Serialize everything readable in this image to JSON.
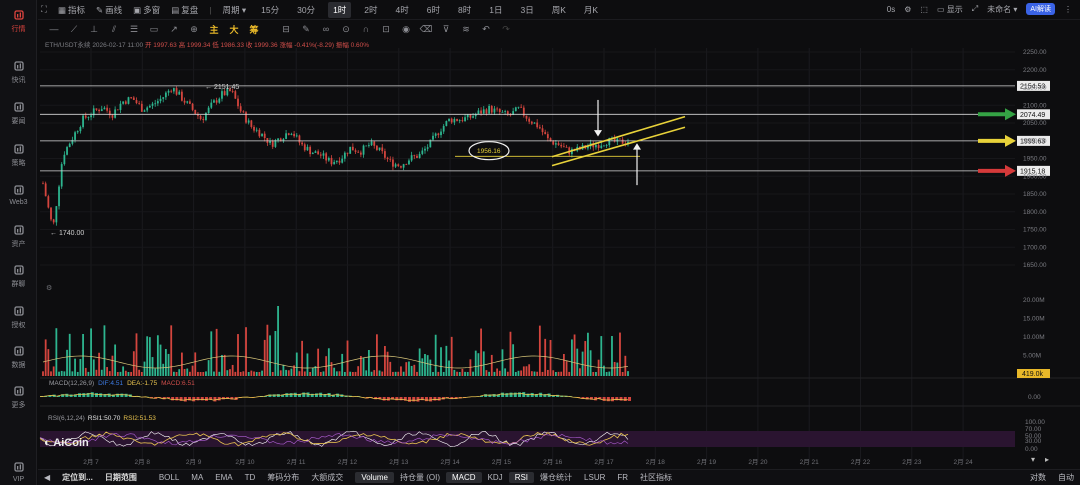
{
  "sidebar": {
    "items": [
      {
        "label": "行情",
        "icon": "chart-bars-icon",
        "active": true
      },
      {
        "label": "快讯",
        "icon": "news-icon"
      },
      {
        "label": "要闻",
        "icon": "document-icon"
      },
      {
        "label": "策略",
        "icon": "strategy-icon"
      },
      {
        "label": "Web3",
        "icon": "web3-icon"
      },
      {
        "label": "资产",
        "icon": "wallet-icon"
      },
      {
        "label": "群聊",
        "icon": "chat-icon"
      },
      {
        "label": "授权",
        "icon": "key-icon"
      },
      {
        "label": "数据",
        "icon": "data-icon"
      },
      {
        "label": "更多",
        "icon": "grid-icon"
      },
      {
        "label": "VIP",
        "icon": "vip-icon"
      }
    ]
  },
  "toolbar": {
    "items": [
      "指标",
      "画线",
      "多窗",
      "复盘",
      "周期"
    ],
    "periods": [
      "15分",
      "30分",
      "1时",
      "2时",
      "4时",
      "6时",
      "8时",
      "1日",
      "3日",
      "周K",
      "月K"
    ],
    "active_period": "1时"
  },
  "right_controls": {
    "timer": "0s",
    "display": "显示",
    "user": "未命名",
    "ai": "AI解读"
  },
  "draw_tools": [
    "主",
    "大",
    "筹"
  ],
  "info": {
    "symbol": "ETH/USDT永续",
    "datetime": "2026-02-17 11:00",
    "open": "开 1997.63",
    "high": "高 1999.34",
    "low": "低 1986.33",
    "close": "收 1999.36",
    "change": "涨幅 -0.41%(-8.29)",
    "amplitude": "振幅 0.60%"
  },
  "chart_data": {
    "type": "candlestick",
    "x_ticks": [
      "2月 7",
      "2月 8",
      "2月 9",
      "2月 10",
      "2月 11",
      "2月 12",
      "2月 13",
      "2月 14",
      "2月 15",
      "2月 16",
      "2月 17",
      "2月 18",
      "2月 19",
      "2月 20",
      "2月 21",
      "2月 22",
      "2月 23",
      "2月 24"
    ],
    "price_ticks": [
      "2250.00",
      "2200.00",
      "2150.00",
      "2100.00",
      "2050.00",
      "2000.00",
      "1950.00",
      "1900.00",
      "1850.00",
      "1800.00",
      "1750.00",
      "1700.00",
      "1650.00"
    ],
    "price_close_path": [
      1880,
      1750,
      1960,
      2010,
      2060,
      2080,
      2095,
      2075,
      2110,
      2120,
      2090,
      2100,
      2120,
      2151,
      2120,
      2090,
      2060,
      2100,
      2130,
      2140,
      2080,
      2040,
      2020,
      1990,
      2010,
      2030,
      1990,
      1970,
      1960,
      1940,
      1950,
      1980,
      1970,
      1990,
      1970,
      1940,
      1930,
      1950,
      1960,
      1990,
      2030,
      2060,
      2060,
      2065,
      2080,
      2090,
      2080,
      2070,
      2090,
      2060,
      2040,
      2000,
      1990,
      1970,
      1975,
      1985,
      1990,
      2000,
      1995,
      2000
    ],
    "horizontal_levels": [
      {
        "price": 2154.53,
        "label": "2154.53",
        "color": "#d8d8d8"
      },
      {
        "price": 2074.49,
        "label": "2074.49",
        "color": "#d8d8d8"
      },
      {
        "price": 1999.63,
        "label": "1999.63",
        "color": "#d8d8d8"
      },
      {
        "price": 1915.18,
        "label": "1915.18",
        "color": "#d8d8d8"
      }
    ],
    "annotations": {
      "high_label": "2151.45",
      "low_label": "1740.00",
      "circle_label": "1956.16"
    },
    "arrows": [
      {
        "price": 2074.49,
        "color": "#35a345"
      },
      {
        "price": 1999.63,
        "color": "#e8d23a"
      },
      {
        "price": 1915.18,
        "color": "#d53a3a"
      }
    ],
    "volume_ticks": [
      "20.00M",
      "15.00M",
      "10.00M",
      "5.00M"
    ],
    "volume_current": "419.0k",
    "macd": {
      "label": "MACD(12,26,9)",
      "dif": "DIF:4.51",
      "dea": "DEA:-1.75",
      "macd": "MACD:6.51",
      "ticks": [
        "0.00"
      ]
    },
    "rsi": {
      "label": "RSI(6,12,24)",
      "rsi1": "RSI1:50.70",
      "rsi2": "RSI2:51.53",
      "ticks": [
        "100.00",
        "70.00",
        "50.00",
        "30.00",
        "0.00"
      ]
    }
  },
  "watermark": "AiCoin",
  "axis_mode": "对数",
  "axis_auto": "自动",
  "bottom": {
    "items": [
      "定位到...",
      "日期范围",
      "BOLL",
      "MA",
      "EMA",
      "TD",
      "筹码分布",
      "大额成交",
      "Volume",
      "持仓量 (OI)",
      "MACD",
      "KDJ",
      "RSI",
      "爆仓统计",
      "LSUR",
      "FR",
      "社区指标"
    ],
    "active": [
      "Volume",
      "MACD",
      "RSI"
    ]
  },
  "colors": {
    "up": "#2db58f",
    "down": "#d4453e",
    "accent": "#e8d23a"
  }
}
